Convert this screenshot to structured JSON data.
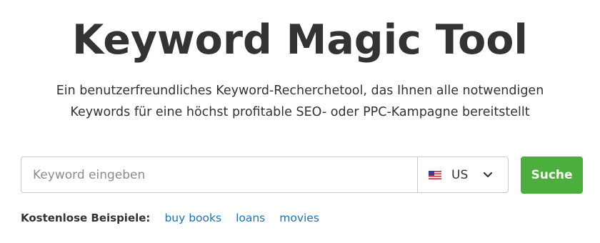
{
  "header": {
    "title": "Keyword Magic Tool",
    "subtitle_line1": "Ein benutzerfreundliches Keyword-Recherchetool, das Ihnen alle notwendigen",
    "subtitle_line2": "Keywords für eine höchst profitable SEO- oder PPC-Kampagne bereitstellt"
  },
  "search": {
    "placeholder": "Keyword eingeben",
    "value": "",
    "database": {
      "flag_icon": "us-flag-icon",
      "selected": "US"
    },
    "button_label": "Suche",
    "button_color": "#4cae3c"
  },
  "examples": {
    "label": "Kostenlose Beispiele:",
    "links": [
      "buy books",
      "loans",
      "movies"
    ],
    "link_color": "#1a73b8"
  }
}
